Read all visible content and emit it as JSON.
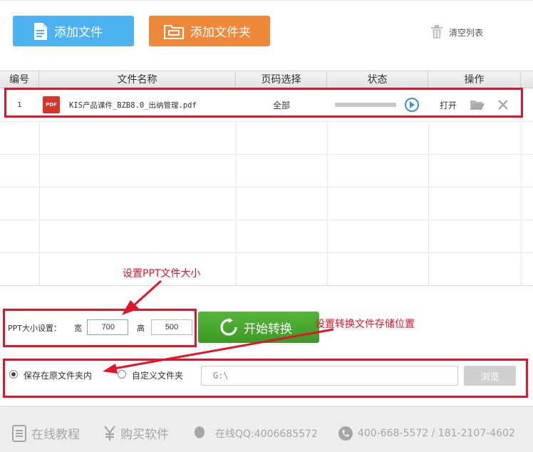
{
  "toolbar": {
    "add_file_label": "添加文件",
    "add_folder_label": "添加文件夹",
    "clear_list_label": "清空列表"
  },
  "table": {
    "headers": [
      "编号",
      "文件名称",
      "页码选择",
      "状态",
      "操作"
    ],
    "rows": [
      {
        "index": "1",
        "file_icon": "PDF",
        "file_name": "KIS产品课件_BZB8.0_出纳管理.pdf",
        "page_selection": "全部",
        "progress": 0,
        "action_open": "打开"
      }
    ]
  },
  "settings": {
    "ppt_size_label": "PPT大小设置：",
    "width_label": "宽",
    "width_value": "700",
    "height_label": "高",
    "height_value": "500",
    "start_button_label": "开始转换",
    "save_in_original_label": "保存在原文件夹内",
    "custom_folder_label": "自定义文件夹",
    "path_value": "G:\\",
    "browse_label": "浏览",
    "selected_option": "save_in_original"
  },
  "annotations": {
    "ppt_size_note": "设置PPT文件大小",
    "save_location_note": "设置转换文件存储位置"
  },
  "footer": {
    "tutorial_label": "在线教程",
    "buy_label": "购买软件",
    "qq_label": "在线QQ:4006685572",
    "phone_label": "400-668-5572 / 181-2107-4602"
  },
  "colors": {
    "add_file_blue": "#4db3f0",
    "add_folder_orange": "#f0883a",
    "start_green": "#3d9a25",
    "annotation_red": "#e0142a",
    "footer_gray": "#a6a6a6"
  }
}
